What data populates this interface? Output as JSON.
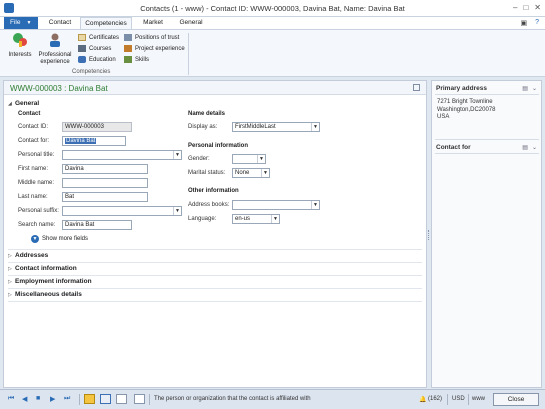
{
  "window": {
    "title": "Contacts (1 - www) - Contact ID: WWW-000003, Davina Bat, Name: Davina Bat"
  },
  "ribbon": {
    "tabs": [
      "File",
      "Contact",
      "Competencies",
      "Market",
      "General"
    ],
    "active_tab": "Competencies",
    "buttons": {
      "interests": "Interests",
      "professional_experience": "Professional experience",
      "certificates": "Certificates",
      "courses": "Courses",
      "education": "Education",
      "positions_of_trust": "Positions of trust",
      "project_experience": "Project experience",
      "skills": "Skills"
    },
    "group_label": "Competencies"
  },
  "record": {
    "title": "WWW-000003 : Davina Bat"
  },
  "general": {
    "header": "General",
    "contact_section": "Contact",
    "contact_id_label": "Contact ID:",
    "contact_id_value": "WWW-000003",
    "contact_for_label": "Contact for:",
    "contact_for_value": "Davina Bat",
    "personal_title_label": "Personal title:",
    "personal_title_value": "",
    "first_name_label": "First name:",
    "first_name_value": "Davina",
    "middle_name_label": "Middle name:",
    "middle_name_value": "",
    "last_name_label": "Last name:",
    "last_name_value": "Bat",
    "personal_suffix_label": "Personal suffix:",
    "personal_suffix_value": "",
    "search_name_label": "Search name:",
    "search_name_value": "Davina Bat",
    "show_more": "Show more fields",
    "name_details_section": "Name details",
    "display_as_label": "Display as:",
    "display_as_value": "FirstMiddleLast",
    "personal_info_section": "Personal information",
    "gender_label": "Gender:",
    "gender_value": "",
    "marital_label": "Marital status:",
    "marital_value": "None",
    "other_info_section": "Other information",
    "address_books_label": "Address books:",
    "address_books_value": "",
    "language_label": "Language:",
    "language_value": "en-us"
  },
  "fasttabs": [
    "Addresses",
    "Contact information",
    "Employment information",
    "Miscellaneous details"
  ],
  "factbox": {
    "primary_address_title": "Primary address",
    "address_lines": [
      "7271 Bright Townline",
      "Washington,DC20078",
      "USA"
    ],
    "contact_for_title": "Contact for"
  },
  "statusbar": {
    "message": "The person or organization that the contact is affiliated with",
    "count": "(162)",
    "currency": "USD",
    "company": "www",
    "close": "Close"
  }
}
